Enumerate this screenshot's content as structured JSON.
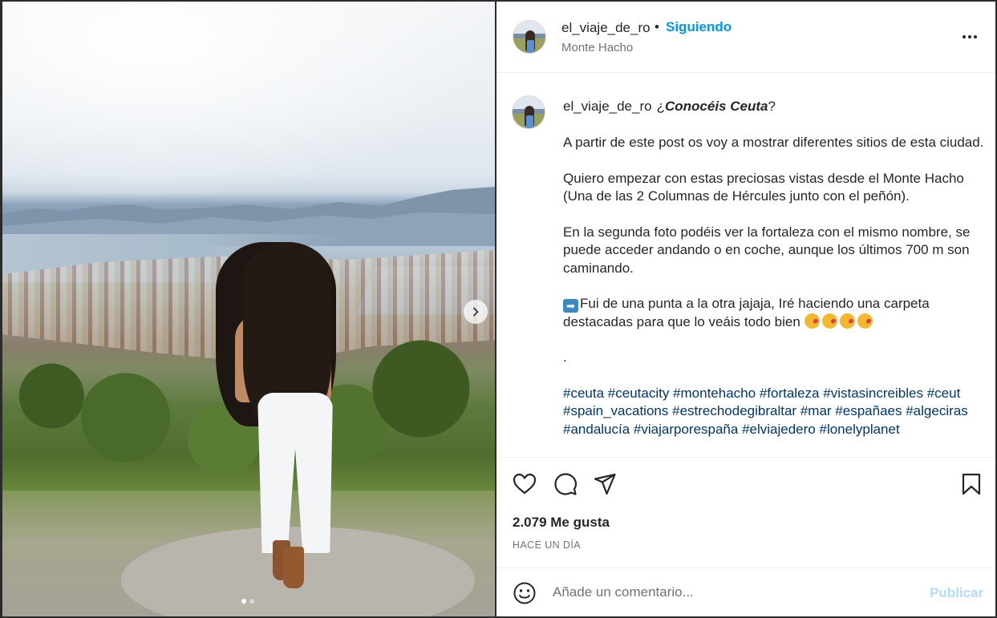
{
  "post": {
    "username": "el_viaje_de_ro",
    "separator": "•",
    "follow_label": "Siguiendo",
    "location": "Monte Hacho",
    "more_icon": "more-options-icon"
  },
  "caption": {
    "username": "el_viaje_de_ro",
    "first_line_prefix": "¿",
    "first_line_bold": "Conocéis Ceuta",
    "first_line_suffix": "?",
    "paragraphs": [
      "A partir de este post os voy a mostrar diferentes sitios de esta ciudad.",
      "Quiero empezar con estas preciosas vistas desde el Monte Hacho (Una de las 2 Columnas de Hércules junto con el peñón).",
      "En la segunda foto podéis ver la fortaleza con el mismo nombre, se puede acceder andando o en coche, aunque los últimos 700 m son caminando."
    ],
    "arrow_glyph": "➡",
    "arrow_text": "Fui de una punta a la otra jajaja, Iré haciendo una carpeta destacadas para que lo veáis todo bien",
    "dot_line": ".",
    "hashtags": [
      "#ceuta",
      "#ceutacity",
      "#montehacho",
      "#fortaleza",
      "#vistasincreibles",
      "#ceut",
      "#spain_vacations",
      "#estrechodegibraltar",
      "#mar",
      "#españaes",
      "#algeciras",
      "#andalucía",
      "#viajarporespaña",
      "#elviajedero",
      "#lonelyplanet"
    ]
  },
  "actions": {
    "like_icon": "heart-icon",
    "comment_icon": "comment-icon",
    "share_icon": "share-icon",
    "save_icon": "bookmark-icon",
    "likes_text": "2.079 Me gusta",
    "time_text": "HACE UN DÍA"
  },
  "comment": {
    "placeholder": "Añade un comentario...",
    "publish_label": "Publicar",
    "publish_color": "#b3dbff"
  },
  "carousel": {
    "total": 2,
    "active": 1
  },
  "colors": {
    "accent": "#0095f6",
    "hashtag": "#00376b",
    "muted": "#737373"
  }
}
